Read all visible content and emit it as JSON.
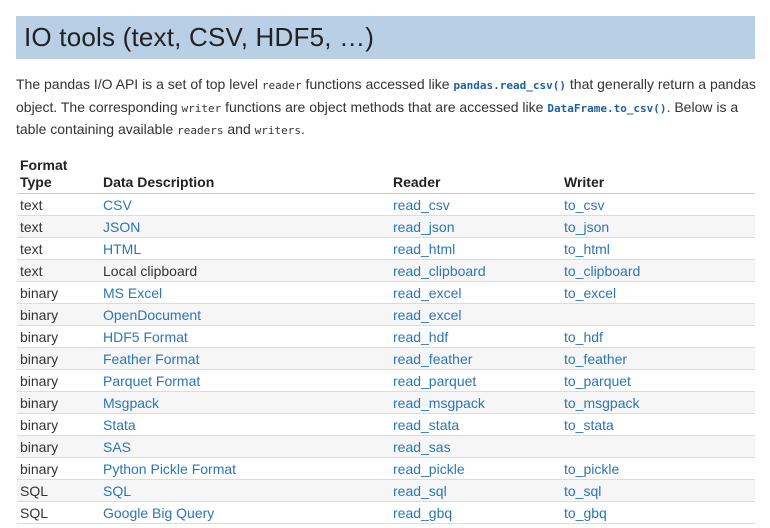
{
  "title": "IO tools (text, CSV, HDF5, …)",
  "intro": {
    "p1": "The pandas I/O API is a set of top level ",
    "code_reader": "reader",
    "p2": " functions accessed like ",
    "code_read_csv": "pandas.read_csv()",
    "p3": " that generally return a pandas object. The corresponding ",
    "code_writer": "writer",
    "p4": " functions are object methods that are accessed like ",
    "code_to_csv": "DataFrame.to_csv()",
    "p5": ". Below is a table containing available ",
    "code_readers": "readers",
    "p6": " and ",
    "code_writers": "writers",
    "p7": "."
  },
  "table": {
    "headers": [
      "Format Type",
      "Data Description",
      "Reader",
      "Writer"
    ],
    "rows": [
      {
        "type": "text",
        "desc": "CSV",
        "desc_link": true,
        "reader": "read_csv",
        "writer": "to_csv"
      },
      {
        "type": "text",
        "desc": "JSON",
        "desc_link": true,
        "reader": "read_json",
        "writer": "to_json"
      },
      {
        "type": "text",
        "desc": "HTML",
        "desc_link": true,
        "reader": "read_html",
        "writer": "to_html"
      },
      {
        "type": "text",
        "desc": "Local clipboard",
        "desc_link": false,
        "reader": "read_clipboard",
        "writer": "to_clipboard"
      },
      {
        "type": "binary",
        "desc": "MS Excel",
        "desc_link": true,
        "reader": "read_excel",
        "writer": "to_excel"
      },
      {
        "type": "binary",
        "desc": "OpenDocument",
        "desc_link": true,
        "reader": "read_excel",
        "writer": ""
      },
      {
        "type": "binary",
        "desc": "HDF5 Format",
        "desc_link": true,
        "reader": "read_hdf",
        "writer": "to_hdf"
      },
      {
        "type": "binary",
        "desc": "Feather Format",
        "desc_link": true,
        "reader": "read_feather",
        "writer": "to_feather"
      },
      {
        "type": "binary",
        "desc": "Parquet Format",
        "desc_link": true,
        "reader": "read_parquet",
        "writer": "to_parquet"
      },
      {
        "type": "binary",
        "desc": "Msgpack",
        "desc_link": true,
        "reader": "read_msgpack",
        "writer": "to_msgpack"
      },
      {
        "type": "binary",
        "desc": "Stata",
        "desc_link": true,
        "reader": "read_stata",
        "writer": "to_stata"
      },
      {
        "type": "binary",
        "desc": "SAS",
        "desc_link": true,
        "reader": "read_sas",
        "writer": ""
      },
      {
        "type": "binary",
        "desc": "Python Pickle Format",
        "desc_link": true,
        "reader": "read_pickle",
        "writer": "to_pickle"
      },
      {
        "type": "SQL",
        "desc": "SQL",
        "desc_link": true,
        "reader": "read_sql",
        "writer": "to_sql"
      },
      {
        "type": "SQL",
        "desc": "Google Big Query",
        "desc_link": true,
        "reader": "read_gbq",
        "writer": "to_gbq"
      }
    ]
  }
}
